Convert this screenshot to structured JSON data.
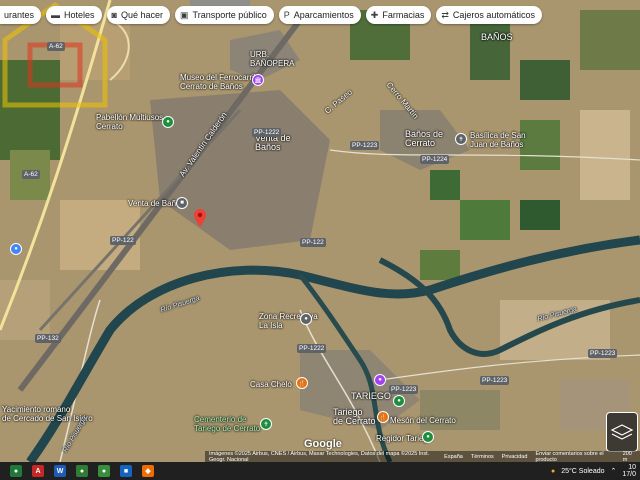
{
  "chips": [
    {
      "icon": "restaurant-icon",
      "label": "urantes"
    },
    {
      "icon": "hotel-icon",
      "label": "Hoteles"
    },
    {
      "icon": "camera-icon",
      "label": "Qué hacer"
    },
    {
      "icon": "bus-icon",
      "label": "Transporte público"
    },
    {
      "icon": "parking-icon",
      "label": "Aparcamientos"
    },
    {
      "icon": "pharmacy-icon",
      "label": "Farmacias"
    },
    {
      "icon": "atm-icon",
      "label": "Cajeros automáticos"
    }
  ],
  "places": {
    "banos_top": "BAÑOS",
    "urb": "URB.\nBAÑOPERA",
    "museo": "Museo del Ferrocarril\nCerrato de Baños",
    "pabellon": "Pabellón Multiusos\nCerrato",
    "venta_banos": "Venta de\nBaños",
    "banos_cerrato": "Baños de\nCerrato",
    "basilica": "Basílica de San\nJuan de Baños",
    "venta_small": "Venta de Baños",
    "c_paseo": "C. Paseo",
    "c_cerro": "Cerro Martín",
    "zona_recreativa": "Zona Recreativa\nLa Isla",
    "casa_chelo": "Casa Chelo",
    "tariego": "TARIEGO",
    "tariego_cerrato": "Tariego\nde Cerrato",
    "meson": "Mesón del Cerrato",
    "regidor": "Regidor Tariego",
    "cementerio": "Cementerio de\nTariego de Cerrato",
    "yacimiento": "Yacimiento romano\nde Cercado de San Isidro",
    "rio1": "Río Pisuerga",
    "rio2": "Río Pisuerga",
    "rio3": "Río Pisuerga",
    "av": "Av. Valentín Calderón"
  },
  "roads": [
    "A-62",
    "A-62",
    "PP-1223",
    "PP-1224",
    "PP-1222",
    "PP-122",
    "PP-122",
    "PP-1223",
    "PP-1222",
    "PP-1223",
    "PP-1223",
    "PP-132"
  ],
  "attribution": {
    "imagery": "Imágenes ©2025 Airbus, CNES / Airbus, Maxar Technologies, Datos del mapa ©2025 Inst. Geogr. Nacional",
    "country": "España",
    "terms": "Términos",
    "privacy": "Privacidad",
    "feedback": "Enviar comentarios sobre el producto",
    "scale": "200 m"
  },
  "logo": "Google",
  "taskbar": {
    "weather": "25°C  Soleado",
    "time": "10",
    "date": "17/0"
  },
  "colors": {
    "river": "#21464e",
    "pin": "#ea4335",
    "poi_green": "#1e8e3e",
    "poi_purple": "#a142f4",
    "poi_orange": "#e8710a"
  }
}
